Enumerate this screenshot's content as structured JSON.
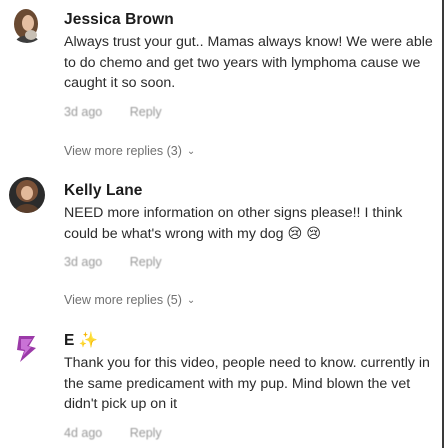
{
  "comments": [
    {
      "author": "Jessica Brown",
      "text": "Always trust your gut.. Mamas always know! We were able to do chemo and get two years with lymphoma cause we caught it so soon.",
      "time": "3d ago",
      "reply_label": "Reply",
      "replies_label": "View more replies (3)"
    },
    {
      "author": "Kelly Lane",
      "text": "NEED more information on other signs please!! I think could be what's wrong with my dog 😢 😢",
      "time": "3d ago",
      "reply_label": "Reply",
      "replies_label": "View more replies (5)"
    },
    {
      "author": "E ✨",
      "text": "Thank you for this video, people need to know. currently in the same predicament with my pup. Mind blown the vet didn't pick up on it",
      "time": "4d ago",
      "reply_label": "Reply"
    }
  ],
  "icons": {
    "chevron": "chevron-down-icon"
  },
  "colors": {
    "avatar3": "#9b3aa8"
  }
}
